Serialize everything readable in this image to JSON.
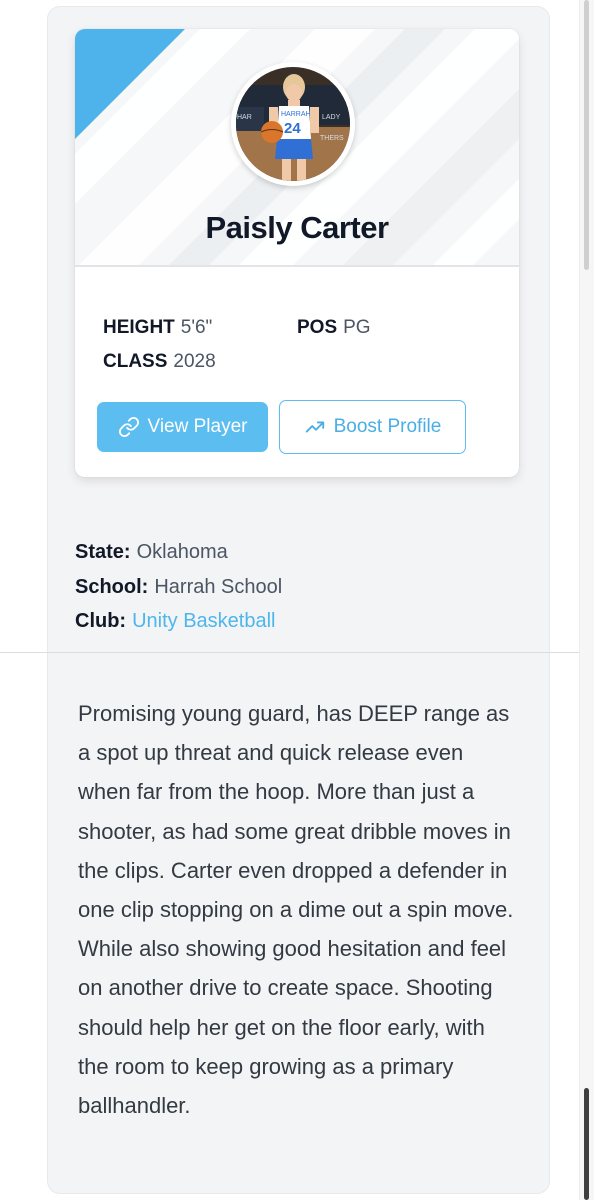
{
  "player": {
    "name": "Paisly Carter",
    "height_label": "HEIGHT",
    "height": "5'6\"",
    "pos_label": "POS",
    "pos": "PG",
    "class_label": "CLASS",
    "class_year": "2028",
    "jersey_number": "24",
    "jersey_text": "HARRAH"
  },
  "actions": {
    "view_label": "View Player",
    "boost_label": "Boost Profile"
  },
  "details": {
    "state_label": "State:",
    "state": "Oklahoma",
    "school_label": "School:",
    "school": "Harrah School",
    "club_label": "Club:",
    "club": "Unity Basketball"
  },
  "bio": "Promising young guard, has DEEP range as a spot up threat and quick release even when far from the hoop. More than just a shooter, as had some great dribble moves in the clips. Carter even dropped a defender in one clip stopping on a dime out a spin move. While also showing good hesitation and feel on another drive to create space. Shooting should help her get on the floor early, with the room to keep growing as a primary ballhandler.",
  "icons": {
    "view": "link-icon",
    "boost": "trending-up-icon"
  },
  "colors": {
    "accent": "#5bbdf0",
    "link": "#4db6ea",
    "name": "#111827"
  }
}
